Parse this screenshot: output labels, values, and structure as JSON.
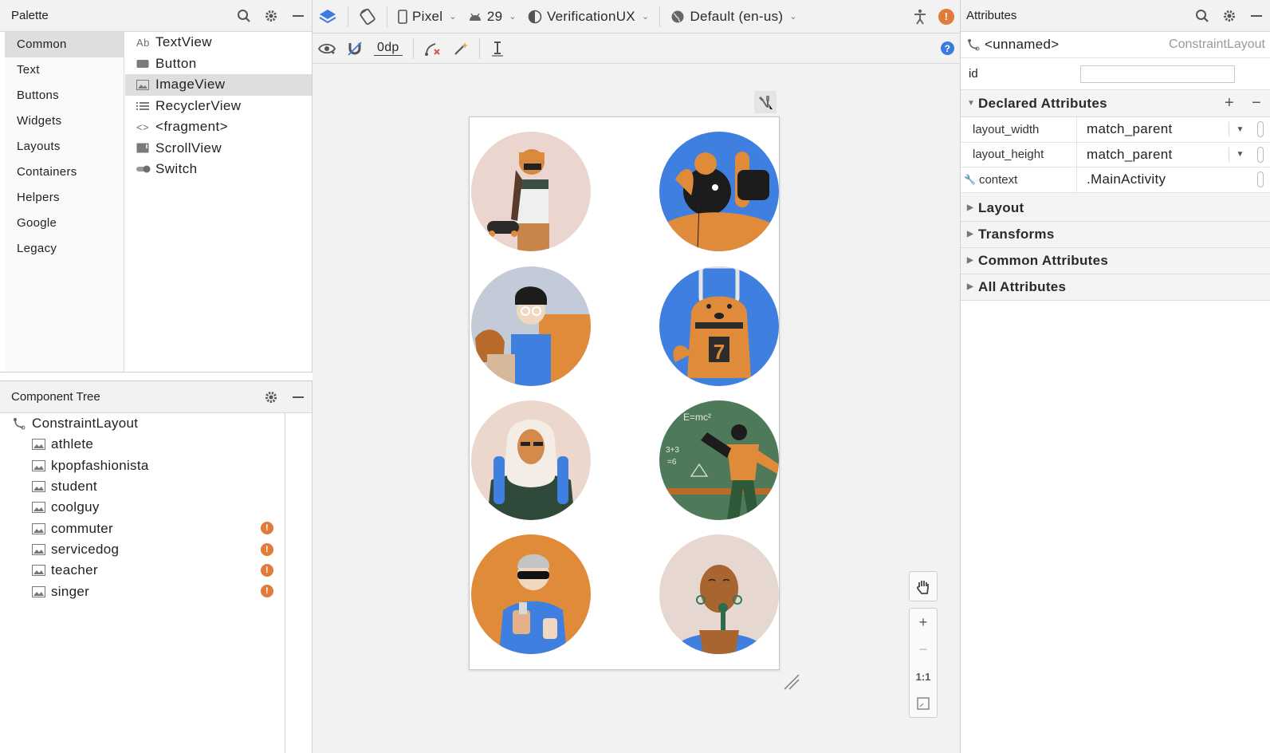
{
  "palette": {
    "title": "Palette",
    "categories": [
      "Common",
      "Text",
      "Buttons",
      "Widgets",
      "Layouts",
      "Containers",
      "Helpers",
      "Google",
      "Legacy"
    ],
    "selected_category": "Common",
    "widgets": [
      {
        "label": "TextView",
        "icon": "text-view-icon",
        "glyph": "Ab"
      },
      {
        "label": "Button",
        "icon": "button-icon",
        "glyph": ""
      },
      {
        "label": "ImageView",
        "icon": "image-view-icon",
        "glyph": ""
      },
      {
        "label": "RecyclerView",
        "icon": "recycler-view-icon",
        "glyph": ""
      },
      {
        "label": "<fragment>",
        "icon": "fragment-icon",
        "glyph": "<>"
      },
      {
        "label": "ScrollView",
        "icon": "scroll-view-icon",
        "glyph": ""
      },
      {
        "label": "Switch",
        "icon": "switch-icon",
        "glyph": ""
      }
    ],
    "selected_widget": "ImageView"
  },
  "tree": {
    "title": "Component Tree",
    "root": "ConstraintLayout",
    "children": [
      {
        "label": "athlete",
        "warning": false
      },
      {
        "label": "kpopfashionista",
        "warning": false
      },
      {
        "label": "student",
        "warning": false
      },
      {
        "label": "coolguy",
        "warning": false
      },
      {
        "label": "commuter",
        "warning": true
      },
      {
        "label": "servicedog",
        "warning": true
      },
      {
        "label": "teacher",
        "warning": true
      },
      {
        "label": "singer",
        "warning": true
      }
    ]
  },
  "toolbar": {
    "device": "Pixel",
    "api": "29",
    "theme": "VerificationUX",
    "locale": "Default (en-us)",
    "margin": "0dp"
  },
  "zoom": {
    "fit_label": "1:1"
  },
  "attributes": {
    "title": "Attributes",
    "component_name": "<unnamed>",
    "component_type": "ConstraintLayout",
    "id_label": "id",
    "id_value": "",
    "declared_title": "Declared Attributes",
    "declared": [
      {
        "name": "layout_width",
        "value": "match_parent",
        "dropdown": true
      },
      {
        "name": "layout_height",
        "value": "match_parent",
        "dropdown": true
      },
      {
        "name": "context",
        "value": ".MainActivity",
        "dropdown": false
      }
    ],
    "sections": [
      "Layout",
      "Transforms",
      "Common Attributes",
      "All Attributes"
    ]
  },
  "colors": {
    "accent_orange": "#e07b39",
    "illustration_blue": "#3f7fe0",
    "illustration_green": "#4f7a5a",
    "help_blue": "#3b7be0"
  }
}
